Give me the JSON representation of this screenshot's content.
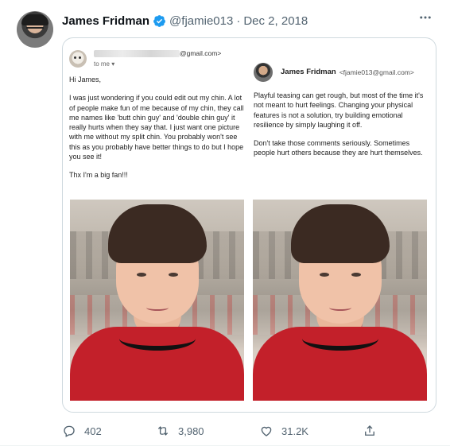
{
  "tweet": {
    "author_name": "James Fridman",
    "handle": "@fjamie013",
    "separator": "·",
    "date": "Dec 2, 2018",
    "more_icon": "ellipsis-icon",
    "verified_color": "#1d9bf0"
  },
  "email_left": {
    "sender_suffix": "@gmail.com>",
    "to_me": "to me",
    "greeting": "Hi James,",
    "body": "I was just wondering if you could edit out my chin. A lot of people make fun of me because of my chin, they call me names like 'butt chin guy' and 'double chin guy' it really hurts when they say that. I just want one picture with me without my split chin. You probably won't see this as you probably have better things to do but I hope you see it!",
    "signoff": "Thx I'm a big fan!!!"
  },
  "email_right": {
    "name": "James Fridman",
    "email": "<fjamie013@gmail.com>",
    "para1": "Playful teasing can get rough, but most of the time it's not meant to hurt feelings. Changing your physical features is not a solution, try building emotional resilience by simply laughing it off.",
    "para2": "Don't take those comments seriously. Sometimes people hurt others because they are hurt themselves."
  },
  "actions": {
    "replies": "402",
    "retweets": "3,980",
    "likes": "31.2K"
  }
}
